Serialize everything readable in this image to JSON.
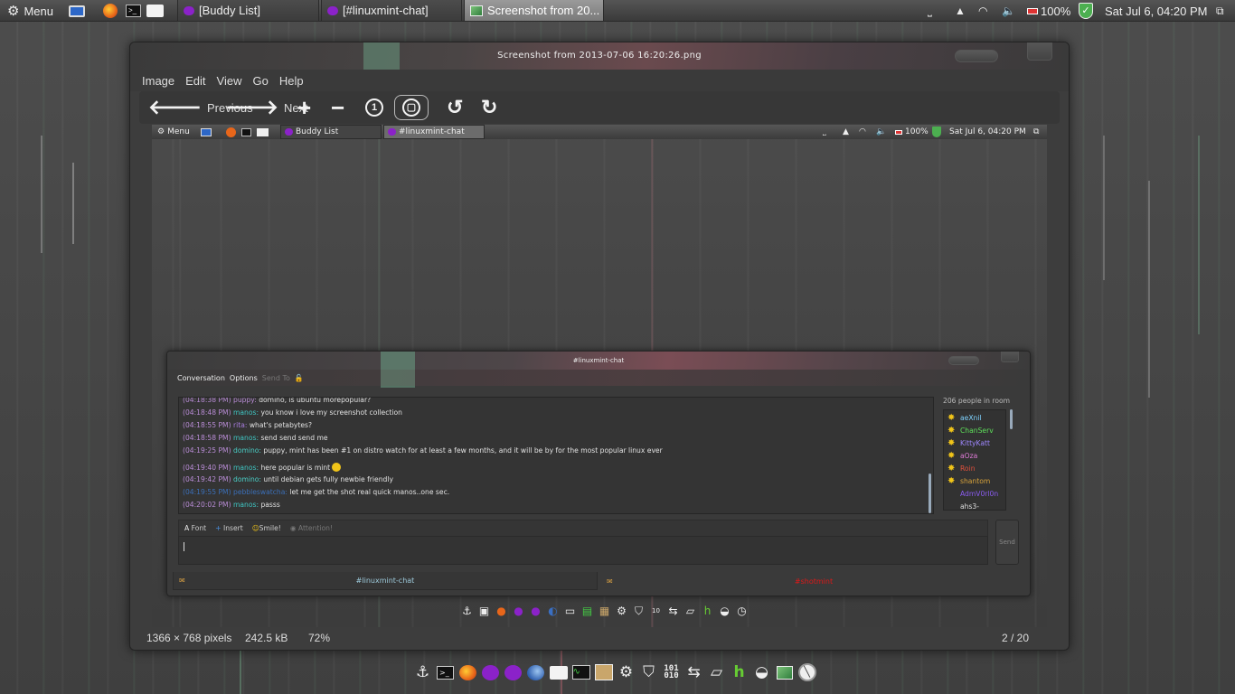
{
  "top_panel": {
    "menu_label": "Menu",
    "tasks": [
      {
        "label": "[Buddy List]"
      },
      {
        "label": "[#linuxmint-chat]"
      },
      {
        "label": "Screenshot from 20..."
      }
    ],
    "battery": "100%",
    "clock": "Sat Jul  6, 04:20 PM"
  },
  "viewer": {
    "title": "Screenshot  from  2013-07-06  16:20:26.png",
    "menu": [
      "Image",
      "Edit",
      "View",
      "Go",
      "Help"
    ],
    "toolbar": {
      "previous_label": "Previous",
      "next_label": "Next"
    },
    "status": {
      "dimensions": "1366 × 768 pixels",
      "filesize": "242.5 kB",
      "zoom": "72%",
      "position": "2 / 20"
    }
  },
  "screenshot": {
    "panel": {
      "menu_label": "Menu",
      "tasks": [
        {
          "label": "Buddy List"
        },
        {
          "label": "#linuxmint-chat"
        }
      ],
      "battery": "100%",
      "clock": "Sat Jul  6, 04:20 PM"
    },
    "chat": {
      "title": "#linuxmint-chat",
      "menu": [
        "Conversation",
        "Options",
        "Send To"
      ],
      "messages": [
        {
          "time": "(04:18:38 PM)",
          "nick": "puppy:",
          "nick_color": "#b98cd6",
          "text": "domino, is ubuntu morepopular?"
        },
        {
          "time": "(04:18:48 PM)",
          "nick": "manos:",
          "nick_color": "#3fc7c4",
          "text": "you know i love my screenshot collection"
        },
        {
          "time": "(04:18:55 PM)",
          "nick": "rita:",
          "nick_color": "#a97de0",
          "text": "what's petabytes?"
        },
        {
          "time": "(04:18:58 PM)",
          "nick": "manos:",
          "nick_color": "#3fc7c4",
          "text": "send send send me"
        },
        {
          "time": "(04:19:25 PM)",
          "nick": "domino:",
          "nick_color": "#4ad0c8",
          "text": "puppy, mint has been #1 on distro watch for at least a few months, and it will be by for the most popular linux ever"
        },
        {
          "time": "(04:19:40 PM)",
          "nick": "manos:",
          "nick_color": "#3fc7c4",
          "text": "here popular is mint"
        },
        {
          "time": "(04:19:42 PM)",
          "nick": "domino:",
          "nick_color": "#4ad0c8",
          "text": "until debian gets fully newbie friendly"
        },
        {
          "time": "(04:19:55 PM)",
          "nick": "pebbleswatcha:",
          "nick_color": "#3b6fb8",
          "text": "let me get the shot real quick manos..one sec."
        },
        {
          "time": "(04:20:02 PM)",
          "nick": "manos:",
          "nick_color": "#3fc7c4",
          "text": "passs"
        }
      ],
      "people_count": "206 people in room",
      "users": [
        {
          "name": "aeXnil",
          "color": "#7fd3ff",
          "op": true
        },
        {
          "name": "ChanServ",
          "color": "#5ee05a",
          "op": true
        },
        {
          "name": "KittyKatt",
          "color": "#9f87ff",
          "op": true
        },
        {
          "name": "aOza",
          "color": "#e07bd8",
          "op": true
        },
        {
          "name": "Roin",
          "color": "#e0503c",
          "op": true
        },
        {
          "name": "shantom",
          "color": "#d6a23a",
          "op": true
        },
        {
          "name": "AdmV0rl0n",
          "color": "#8a5cf0",
          "op": false
        },
        {
          "name": "ahs3-",
          "color": "#dddddd",
          "op": false
        }
      ],
      "compose_toolbar": [
        "Font",
        "Insert",
        "Smile!",
        "Attention!"
      ],
      "send_label": "Send",
      "tabs": [
        {
          "label": "#linuxmint-chat"
        },
        {
          "label": "#shotmint"
        }
      ]
    }
  },
  "colors": {
    "panel_bg": "#3f3f3f",
    "window_bg": "#3d3d3d",
    "accent_purple": "#8b22c9",
    "highlight_red": "#e01818"
  }
}
